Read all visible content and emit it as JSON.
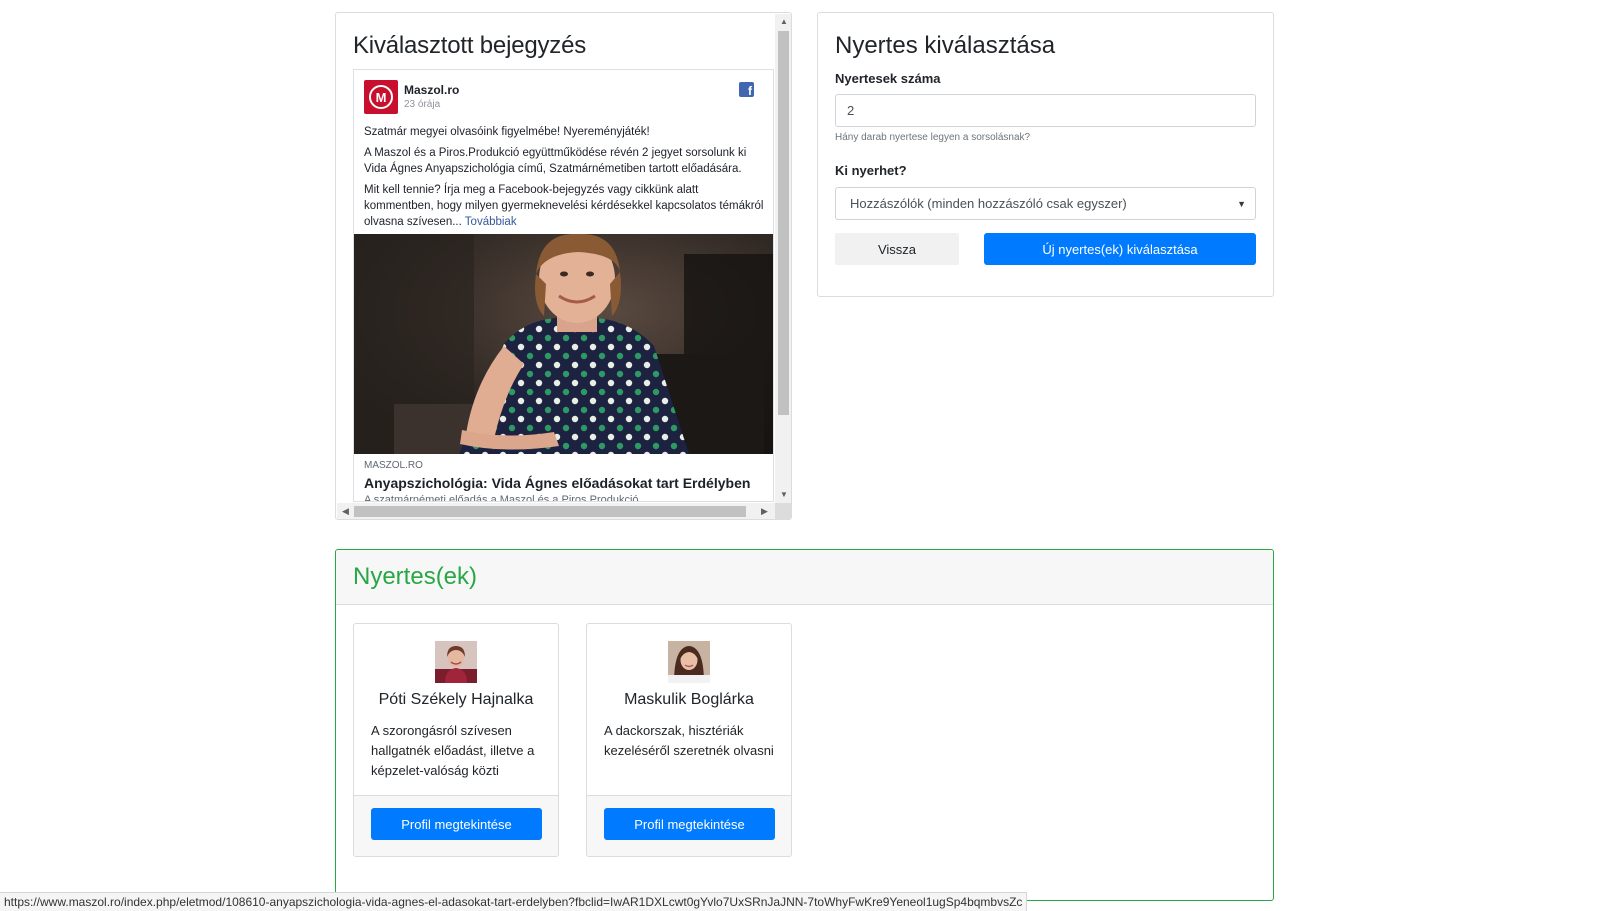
{
  "selected_post": {
    "title": "Kiválasztott bejegyzés",
    "page_name": "Maszol.ro",
    "time": "23 órája",
    "logo_letter": "M",
    "fb_icon": "f",
    "paragraphs": [
      "Szatmár megyei olvasóink figyelmébe! Nyereményjáték!",
      "A Maszol és a Piros.Produkció együttműködése révén 2 jegyet sorsolunk ki Vida Ágnes Anyapszichológia című, Szatmárnémetiben tartott előadására."
    ],
    "paragraph3": "Mit kell tennie? Írja meg a Facebook-bejegyzés vagy cikkünk alatt kommentben, hogy milyen gyermeknevelési kérdésekkel kapcsolatos témákról olvasna szívesen... ",
    "more_link": "Továbbiak",
    "link_domain": "MASZOL.RO",
    "link_title": "Anyapszichológia: Vida Ágnes előadásokat tart Erdélyben",
    "link_desc": "A szatmárnémeti előadás a Maszol és a Piros.Produkció"
  },
  "winner_select": {
    "title": "Nyertes kiválasztása",
    "count_label": "Nyertesek száma",
    "count_value": "2",
    "count_help": "Hány darab nyertese legyen a sorsolásnak?",
    "who_label": "Ki nyerhet?",
    "who_value": "Hozzászólók (minden hozzászóló csak egyszer)",
    "back_button": "Vissza",
    "new_button": "Új nyertes(ek) kiválasztása"
  },
  "winners": {
    "title": "Nyertes(ek)",
    "items": [
      {
        "name": "Póti Székely Hajnalka",
        "description": "A szorongásról szívesen hallgatnék előadást, illetve a képzelet-valóság közti",
        "button": "Profil megtekintése"
      },
      {
        "name": "Maskulik Boglárka",
        "description": "A dackorszak, hisztériák kezeléséről szeretnék olvasni",
        "button": "Profil megtekintése"
      }
    ]
  },
  "status_url": "https://www.maszol.ro/index.php/eletmod/108610-anyapszichologia-vida-agnes-el-adasokat-tart-erdelyben?fbclid=IwAR1DXLcwt0gYvlo7UxSRnJaJNN-7toWhyFwKre9Yeneol1ugSp4bqmbvsZc",
  "colors": {
    "primary": "#007bff",
    "success": "#28a745",
    "maszol_red": "#c8102e",
    "facebook_blue": "#4267b2"
  }
}
